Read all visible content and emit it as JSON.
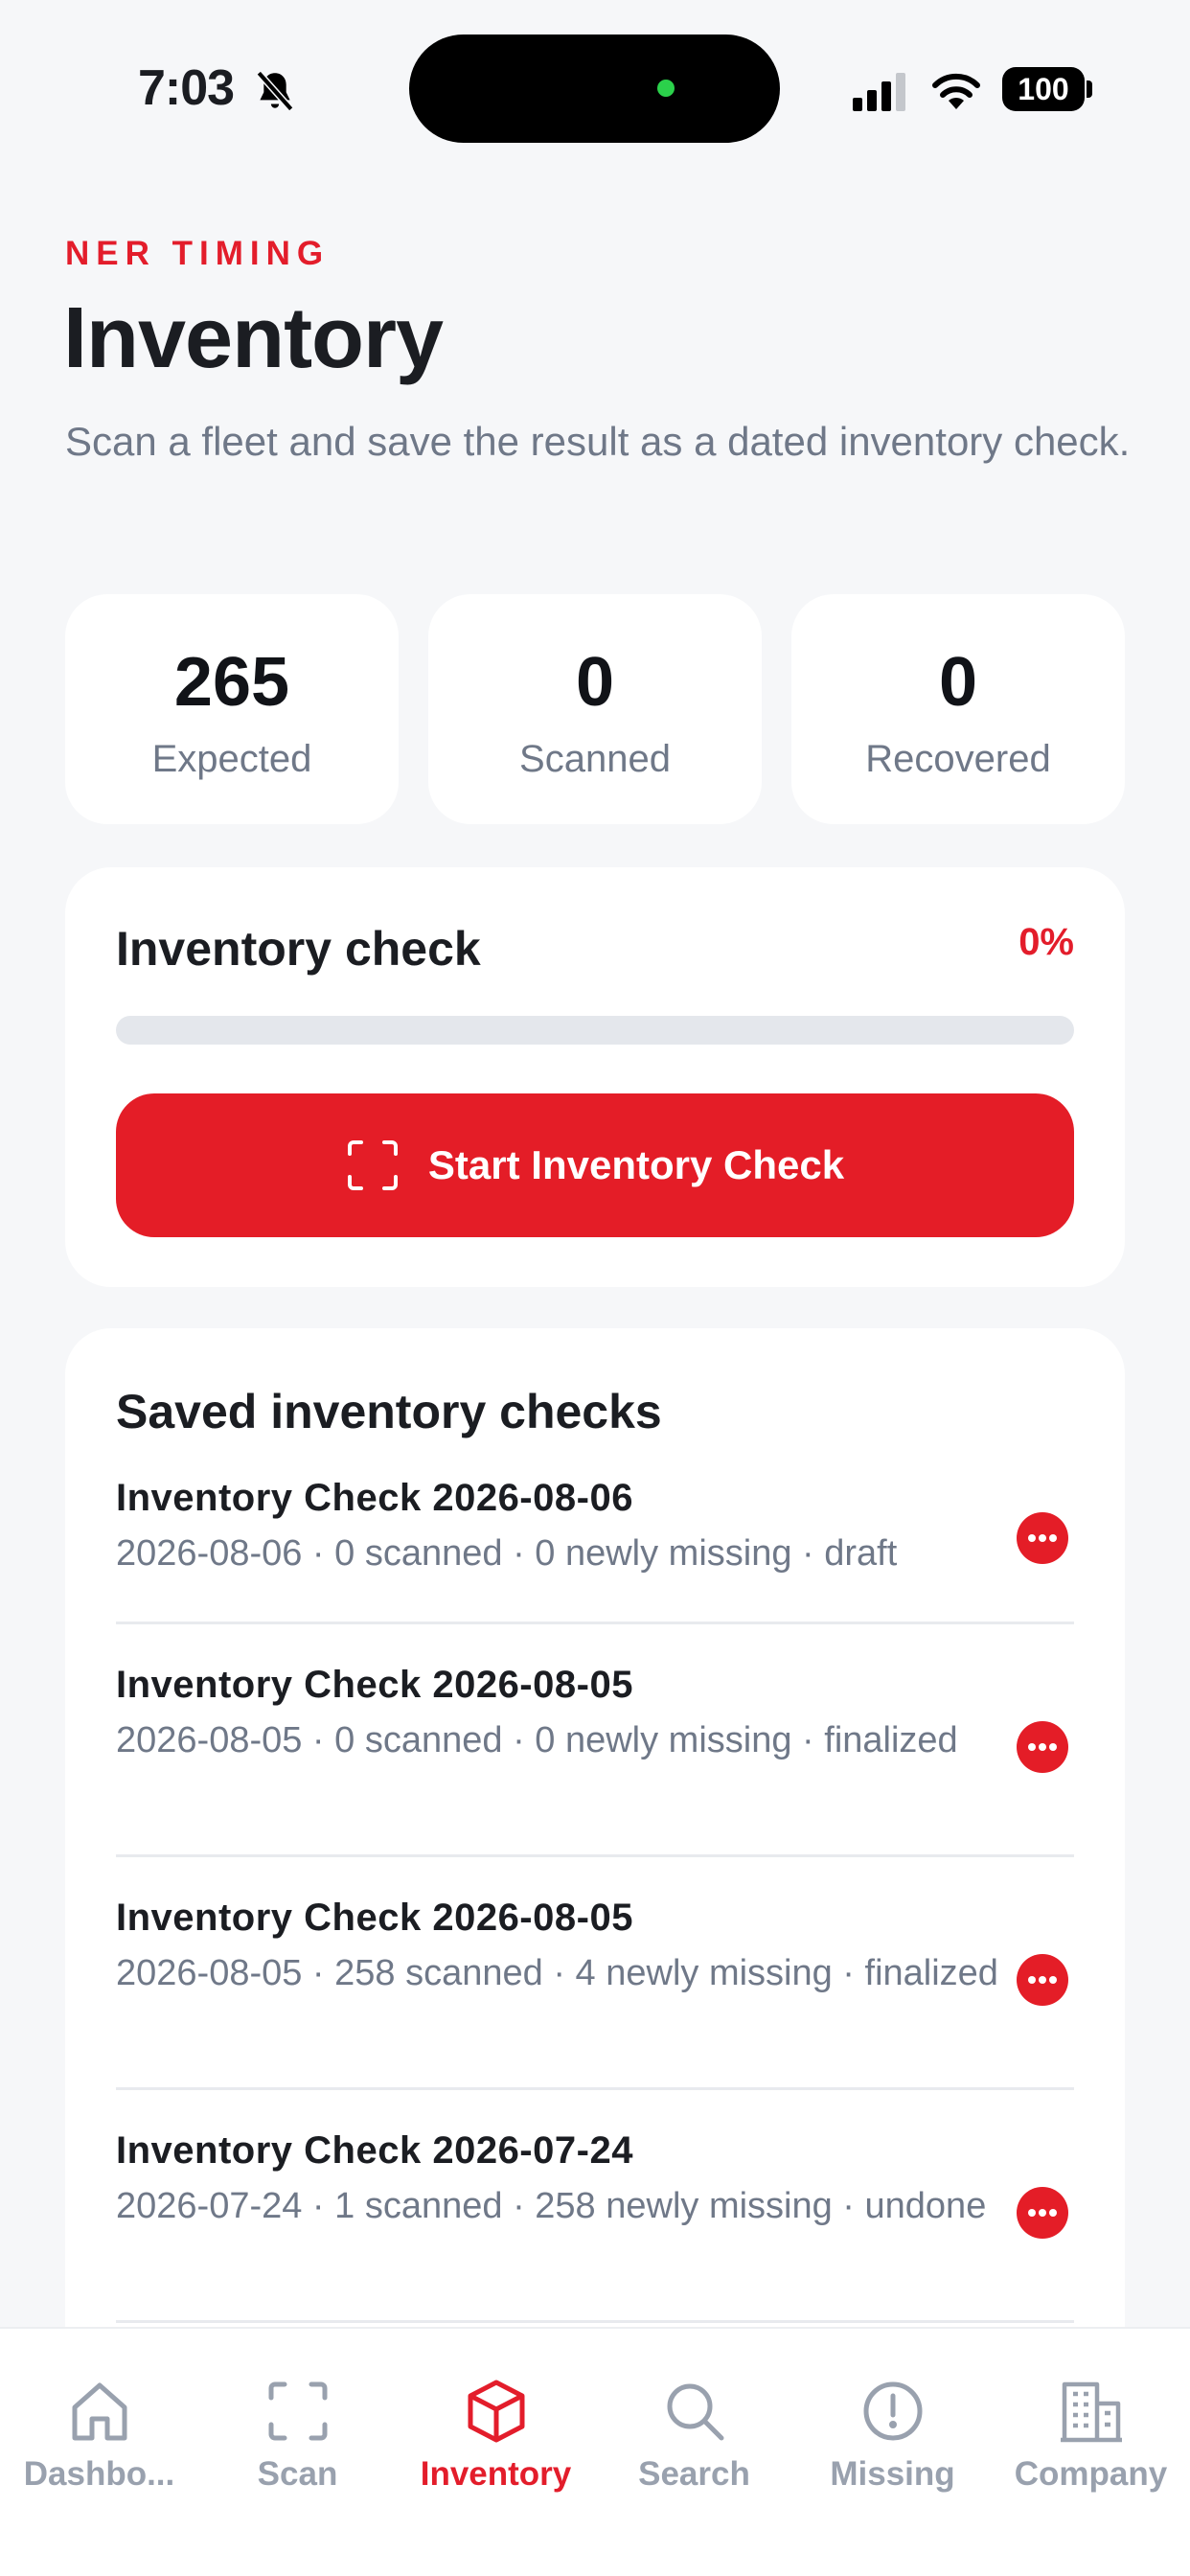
{
  "status_bar": {
    "time": "7:03",
    "battery": "100"
  },
  "header": {
    "eyebrow": "NER TIMING",
    "title": "Inventory",
    "subtitle": "Scan a fleet and save the result as a dated inventory check."
  },
  "stats": [
    {
      "value": "265",
      "label": "Expected"
    },
    {
      "value": "0",
      "label": "Scanned"
    },
    {
      "value": "0",
      "label": "Recovered"
    }
  ],
  "inventory_check": {
    "title": "Inventory check",
    "percent_label": "0%",
    "progress": 0,
    "start_button_label": "Start Inventory Check"
  },
  "saved_checks": {
    "title": "Saved inventory checks",
    "items": [
      {
        "title": "Inventory Check 2026-08-06",
        "meta": "2026-08-06 · 0 scanned · 0 newly missing · draft"
      },
      {
        "title": "Inventory Check 2026-08-05",
        "meta": "2026-08-05 · 0 scanned · 0 newly missing · finalized"
      },
      {
        "title": "Inventory Check 2026-08-05",
        "meta": "2026-08-05 · 258 scanned · 4 newly missing · finalized"
      },
      {
        "title": "Inventory Check 2026-07-24",
        "meta": "2026-07-24 · 1 scanned · 258 newly missing · undone"
      }
    ]
  },
  "tab_bar": {
    "active": "Inventory",
    "tabs": [
      {
        "label": "Dashbo...",
        "icon": "home-icon"
      },
      {
        "label": "Scan",
        "icon": "scan-icon"
      },
      {
        "label": "Inventory",
        "icon": "cube-icon"
      },
      {
        "label": "Search",
        "icon": "search-icon"
      },
      {
        "label": "Missing",
        "icon": "alert-icon"
      },
      {
        "label": "Company",
        "icon": "building-icon"
      }
    ]
  },
  "colors": {
    "accent": "#e41d27",
    "background": "#f6f7f9",
    "muted_text": "#6f7888",
    "inactive_tab": "#99a1ae"
  }
}
